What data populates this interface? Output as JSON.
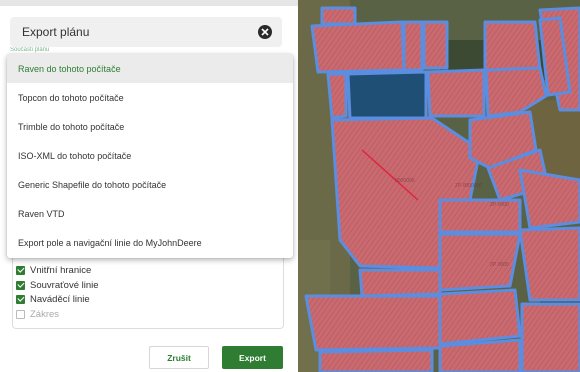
{
  "dialog": {
    "title": "Export plánu",
    "partial_label": "Součásti plánu"
  },
  "dropdown": {
    "selected_index": 0,
    "options": [
      "Raven do tohoto počítače",
      "Topcon do tohoto počítače",
      "Trimble do tohoto počítače",
      "ISO-XML do tohoto počítače",
      "Generic Shapefile do tohoto počítače",
      "Raven VTD",
      "Export pole a navigační linie do MyJohnDeere"
    ]
  },
  "checkboxes": [
    {
      "label": "Vnitřní hranice",
      "checked": true
    },
    {
      "label": "Souvraťové linie",
      "checked": true
    },
    {
      "label": "Naváděcí linie",
      "checked": true
    },
    {
      "label": "Zákres",
      "checked": false
    }
  ],
  "buttons": {
    "cancel": "Zrušit",
    "export": "Export"
  },
  "colors": {
    "accent": "#2e7d32",
    "field_fill": "#c9686e",
    "field_border": "#5b8de0",
    "map_bg": "#4f5a3d"
  }
}
